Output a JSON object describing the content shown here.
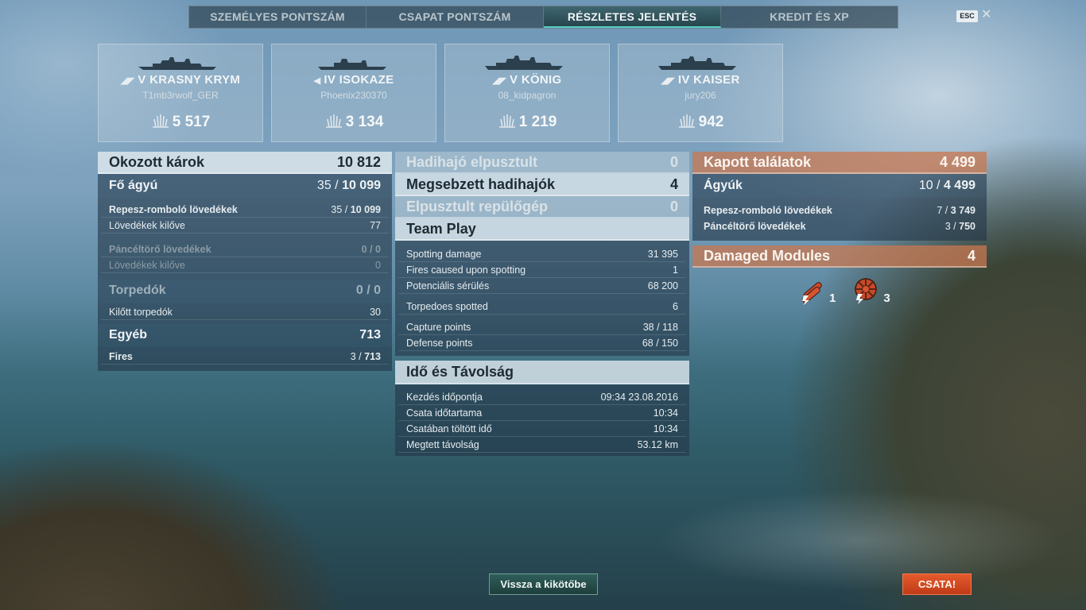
{
  "tabs": [
    {
      "label": "SZEMÉLYES PONTSZÁM"
    },
    {
      "label": "CSAPAT PONTSZÁM"
    },
    {
      "label": "RÉSZLETES JELENTÉS"
    },
    {
      "label": "KREDIT ÉS XP"
    }
  ],
  "active_tab": 2,
  "esc_label": "ESC",
  "close_glyph": "✕",
  "ships": [
    {
      "tier": "V",
      "name": "KRASNY KRYM",
      "player": "T1mb3rwolf_GER",
      "xp": "5 517",
      "class_icon": "cruiser-icon"
    },
    {
      "tier": "IV",
      "name": "ISOKAZE",
      "player": "Phoenix230370",
      "xp": "3 134",
      "class_icon": "destroyer-icon"
    },
    {
      "tier": "V",
      "name": "KÖNIG",
      "player": "08_kidpagron",
      "xp": "1 219",
      "class_icon": "battleship-icon"
    },
    {
      "tier": "IV",
      "name": "KAISER",
      "player": "jury206",
      "xp": "942",
      "class_icon": "battleship-icon"
    }
  ],
  "left": {
    "damage_label": "Okozott károk",
    "damage_value": "10 812",
    "main_guns_label": "Fő ágyú",
    "main_guns_hits": "35 /",
    "main_guns_value": "10 099",
    "he_label": "Repesz-romboló lövedékek",
    "he_hits": "35 /",
    "he_value": "10 099",
    "he_fired_label": "Lövedékek kilőve",
    "he_fired_value": "77",
    "ap_label": "Páncéltörő lövedékek",
    "ap_value": "0 / 0",
    "ap_fired_label": "Lövedékek kilőve",
    "ap_fired_value": "0",
    "torp_label": "Torpedók",
    "torp_value": "0 / 0",
    "torp_fired_label": "Kilőtt torpedók",
    "torp_fired_value": "30",
    "other_label": "Egyéb",
    "other_value": "713",
    "fires_label": "Fires",
    "fires_hits": "3 /",
    "fires_value": "713"
  },
  "middle": {
    "destroyed_label": "Hadihajó elpusztult",
    "destroyed_value": "0",
    "damaged_label": "Megsebzett hadihajók",
    "damaged_value": "4",
    "planes_label": "Elpusztult repülőgép",
    "planes_value": "0",
    "team_label": "Team Play",
    "spotting_label": "Spotting damage",
    "spotting_value": "31 395",
    "fires_spot_label": "Fires caused upon spotting",
    "fires_spot_value": "1",
    "potential_label": "Potenciális sérülés",
    "potential_value": "68 200",
    "torp_spot_label": "Torpedoes spotted",
    "torp_spot_value": "6",
    "capture_label": "Capture points",
    "capture_value": "38 / 118",
    "defense_label": "Defense points",
    "defense_value": "68 / 150",
    "time_label": "Idő és Távolság",
    "start_label": "Kezdés időpontja",
    "start_value": "09:34  23.08.2016",
    "duration_label": "Csata időtartama",
    "duration_value": "10:34",
    "in_battle_label": "Csatában töltött idő",
    "in_battle_value": "10:34",
    "distance_label": "Megtett távolság",
    "distance_value": "53.12 km"
  },
  "right": {
    "received_label": "Kapott találatok",
    "received_value": "4 499",
    "guns_label": "Ágyúk",
    "guns_hits": "10 /",
    "guns_value": "4 499",
    "he_label": "Repesz-romboló lövedékek",
    "he_hits": "7 /",
    "he_value": "3 749",
    "ap_label": "Páncéltörő lövedékek",
    "ap_hits": "3 /",
    "ap_value": "750",
    "modules_label": "Damaged Modules",
    "modules_value": "4",
    "module_items": [
      {
        "icon": "torpedo-tubes-icon",
        "count": "1"
      },
      {
        "icon": "engine-icon",
        "count": "3"
      }
    ]
  },
  "buttons": {
    "port": "Vissza a kikötőbe",
    "battle": "CSATA!"
  },
  "colors": {
    "accent_teal": "#58d0c0",
    "battle_orange": "#d94a22",
    "received_header": "#c8784f"
  }
}
